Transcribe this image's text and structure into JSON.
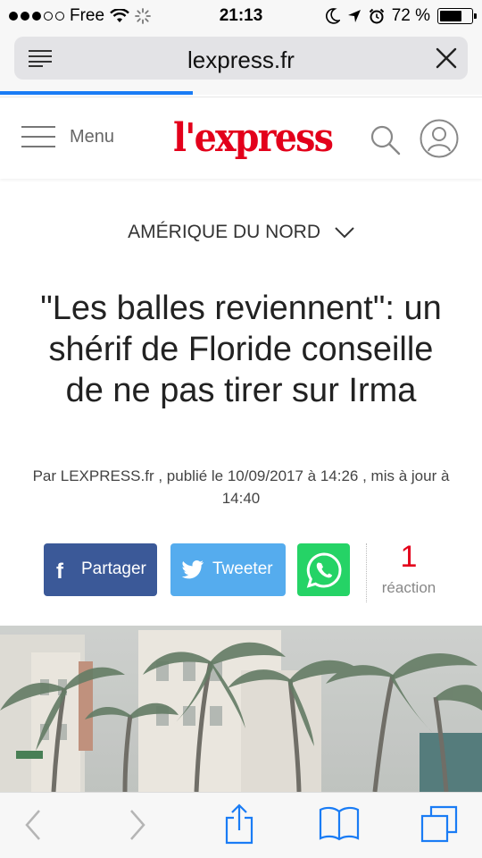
{
  "status_bar": {
    "carrier": "Free",
    "time": "21:13",
    "battery": "72 %",
    "battery_level": 0.72
  },
  "browser": {
    "url": "lexpress.fr",
    "load_progress": 0.4
  },
  "site": {
    "menu_label": "Menu",
    "logo_text": "l'express",
    "brand_color": "#e3001b"
  },
  "article": {
    "section": "AMÉRIQUE DU NORD",
    "headline": "\"Les balles reviennent\": un shérif de Floride conseille de ne pas tirer sur Irma",
    "byline": "Par LEXPRESS.fr , publié le 10/09/2017 à 14:26 , mis à jour à 14:40"
  },
  "share": {
    "facebook_label": "Partager",
    "twitter_label": "Tweeter",
    "facebook_color": "#3b5998",
    "twitter_color": "#55acee",
    "whatsapp_color": "#25d366",
    "reaction_count": "1",
    "reaction_label": "réaction"
  },
  "icons": {
    "reader": "reader-view-icon",
    "close": "close-icon",
    "search": "search-icon",
    "user": "user-icon",
    "back": "back-icon",
    "forward": "forward-icon",
    "share": "share-icon",
    "bookmarks": "bookmarks-icon",
    "tabs": "tabs-icon"
  }
}
